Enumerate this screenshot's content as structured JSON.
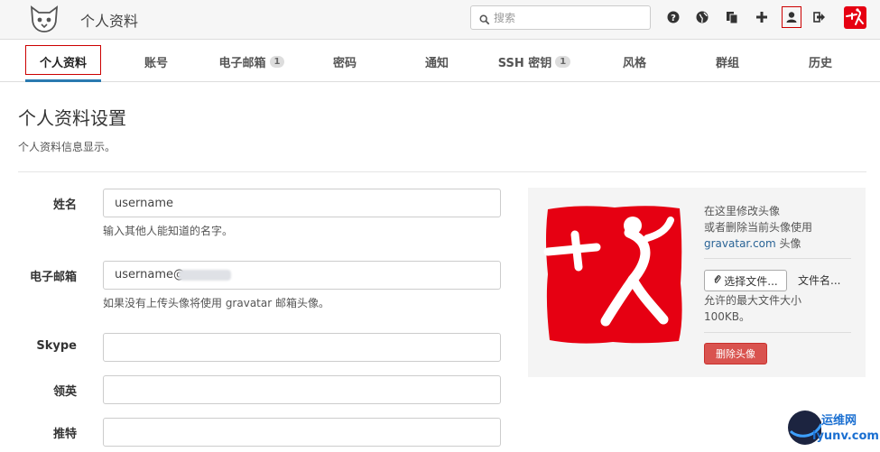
{
  "header": {
    "app_title": "个人资料",
    "search_placeholder": "搜索"
  },
  "tabs": [
    {
      "label": "个人资料",
      "active": true
    },
    {
      "label": "账号"
    },
    {
      "label": "电子邮箱",
      "badge": "1"
    },
    {
      "label": "密码"
    },
    {
      "label": "通知"
    },
    {
      "label": "SSH 密钥",
      "badge": "1"
    },
    {
      "label": "风格"
    },
    {
      "label": "群组"
    },
    {
      "label": "历史"
    }
  ],
  "page": {
    "title": "个人资料设置",
    "subtitle": "个人资料信息显示。"
  },
  "form": {
    "name_label": "姓名",
    "name_value": "username",
    "name_help": "输入其他人能知道的名字。",
    "email_label": "电子邮箱",
    "email_value": "username@",
    "email_help": "如果没有上传头像将使用 gravatar 邮箱头像。",
    "skype_label": "Skype",
    "skype_value": "",
    "linkedin_label": "领英",
    "linkedin_value": "",
    "twitter_label": "推特",
    "twitter_value": ""
  },
  "avatar_panel": {
    "line1": "在这里修改头像",
    "line2": "或者删除当前头像使用",
    "gravatar_link": "gravatar.com",
    "gravatar_suffix": " 头像",
    "choose_button": "选择文件...",
    "file_name": "文件名...",
    "size_note_1": "允许的最大文件大小",
    "size_note_2": "100KB。",
    "delete_button": "删除头像"
  },
  "watermark": {
    "line1": "运维网",
    "line2": "iyunv.com"
  },
  "colors": {
    "accent": "#2a7ab0",
    "danger": "#d9534f",
    "highlight_frame": "#cc0000",
    "avatar_red": "#e60012"
  },
  "icons": [
    "search-icon",
    "help-icon",
    "globe-icon",
    "copy-icon",
    "plus-icon",
    "user-icon",
    "sign-out-icon"
  ]
}
